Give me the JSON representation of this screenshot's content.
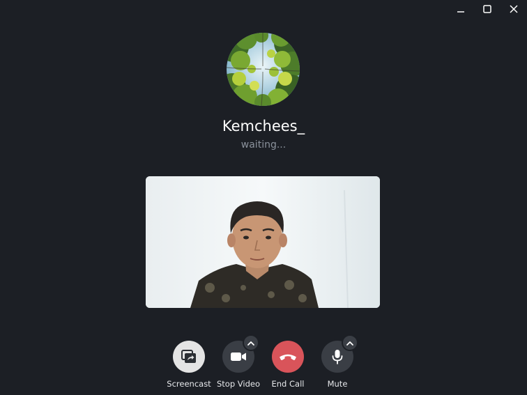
{
  "window": {
    "controls": [
      "minimize-icon",
      "maximize-icon",
      "close-icon"
    ]
  },
  "peer": {
    "name": "Kemchees_",
    "status": "waiting..."
  },
  "controls": {
    "screencast": {
      "label": "Screencast",
      "icon": "screencast-icon"
    },
    "stop_video": {
      "label": "Stop Video",
      "icon": "video-camera-icon"
    },
    "end_call": {
      "label": "End Call",
      "icon": "phone-hangup-icon"
    },
    "mute": {
      "label": "Mute",
      "icon": "microphone-icon"
    }
  },
  "colors": {
    "background": "#1c1f25",
    "button": "#3a3e45",
    "end_call": "#d9545a",
    "status_text": "#8b929c"
  }
}
